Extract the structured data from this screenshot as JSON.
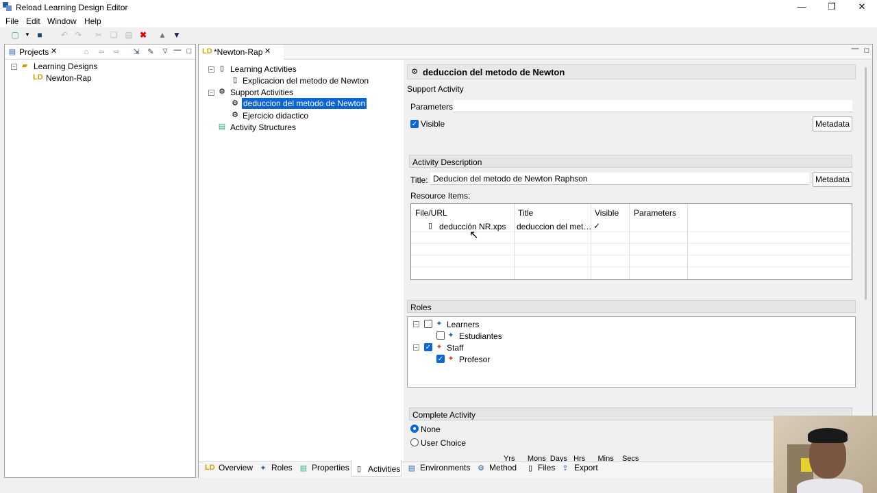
{
  "window": {
    "title": "Reload Learning Design Editor",
    "minimize": "—",
    "restore": "❐",
    "close": "✕"
  },
  "menu": [
    "File",
    "Edit",
    "Window",
    "Help"
  ],
  "projects": {
    "tab": "Projects",
    "tree_root": "Learning Designs",
    "tree_child": "Newton-Rap"
  },
  "editor": {
    "tab": "*Newton-Rap",
    "tree": {
      "learning_activities": "Learning Activities",
      "explicacion": "Explicacion del metodo de Newton",
      "support_activities": "Support Activities",
      "deduccion": "deduccion del metodo de Newton",
      "ejercicio": "Ejercicio didactico",
      "activity_structures": "Activity Structures"
    }
  },
  "detail": {
    "heading": "deduccion del metodo de Newton",
    "subtitle": "Support Activity",
    "parameters_label": "Parameters:",
    "parameters_value": "",
    "visible_label": "Visible",
    "metadata": "Metadata",
    "activity_description": "Activity Description",
    "title_label": "Title:",
    "title_value": "Deducion del metodo de Newton Raphson",
    "resource_items": "Resource Items:",
    "table": {
      "headers": [
        "File/URL",
        "Title",
        "Visible",
        "Parameters"
      ],
      "row": {
        "file": "deducción NR.xps",
        "title": "deduccion del met…",
        "visible": "✓",
        "parameters": ""
      }
    },
    "roles": {
      "header": "Roles",
      "learners": "Learners",
      "estudiantes": "Estudiantes",
      "staff": "Staff",
      "profesor": "Profesor"
    },
    "complete": {
      "header": "Complete Activity",
      "none": "None",
      "user_choice": "User Choice",
      "units": "Yrs      Mons  Days   Hrs      Mins    Secs"
    }
  },
  "bottom_tabs": [
    "Overview",
    "Roles",
    "Properties",
    "Activities",
    "Environments",
    "Method",
    "Files",
    "Export"
  ],
  "colors": {
    "selection": "#0a65d8",
    "accent": "#c8a000"
  }
}
